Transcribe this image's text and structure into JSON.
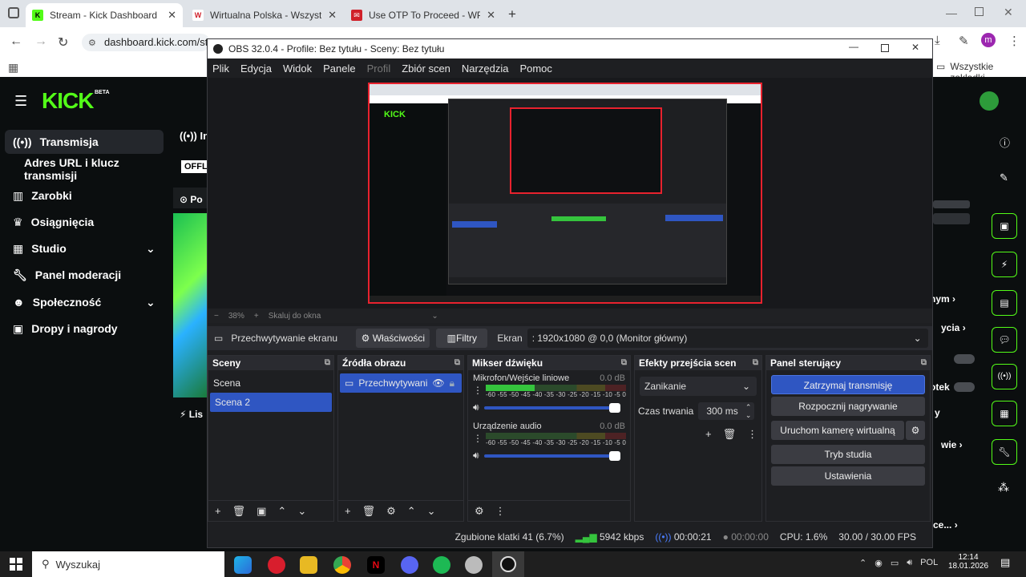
{
  "browser": {
    "tabs": [
      {
        "title": "Stream - Kick Dashboard",
        "active": true
      },
      {
        "title": "Wirtualna Polska - Wszystko co",
        "active": false
      },
      {
        "title": "Use OTP To Proceed - WP Pocz",
        "active": false
      }
    ],
    "address": "dashboard.kick.com/stre",
    "bookmarks_label": "Wszystkie zakładki"
  },
  "kick": {
    "logo": "KICK",
    "logo_badge": "BETA",
    "nav": [
      {
        "label": "Transmisja",
        "icon": "broadcast-icon",
        "active": true
      },
      {
        "label": "Adres URL i klucz transmisji",
        "icon": "",
        "active": false
      },
      {
        "label": "Zarobki",
        "icon": "earnings-icon",
        "active": false
      },
      {
        "label": "Osiągnięcia",
        "icon": "trophy-icon",
        "active": false
      },
      {
        "label": "Studio",
        "icon": "studio-icon",
        "active": false,
        "expandable": true
      },
      {
        "label": "Panel moderacji",
        "icon": "wrench-icon",
        "active": false
      },
      {
        "label": "Społeczność",
        "icon": "community-icon",
        "active": false,
        "expandable": true
      },
      {
        "label": "Dropy i nagrody",
        "icon": "gift-icon",
        "active": false
      }
    ],
    "info_header": "Inf",
    "offline_badge": "OFFL",
    "preview_header": "Po",
    "list_header": "Lis",
    "right_items": [
      "nym",
      "ycia",
      "otek",
      "y",
      "wie",
      "ce..."
    ]
  },
  "obs": {
    "title": "OBS 32.0.4 - Profile: Bez tytułu - Sceny: Bez tytułu",
    "menu": [
      "Plik",
      "Edycja",
      "Widok",
      "Panele",
      "Profil",
      "Zbiór scen",
      "Narzędzia",
      "Pomoc"
    ],
    "zoom": "38%",
    "zoom_mode": "Skaluj do okna",
    "source_bar": {
      "source_name": "Przechwytywanie ekranu",
      "properties_label": "Właściwości",
      "filters_label": "Filtry",
      "screen_label": "Ekran",
      "screen_value": ": 1920x1080 @ 0,0 (Monitor główny)"
    },
    "scenes": {
      "title": "Sceny",
      "items": [
        {
          "name": "Scena",
          "selected": false
        },
        {
          "name": "Scena 2",
          "selected": true
        }
      ]
    },
    "sources": {
      "title": "Źródła obrazu",
      "items": [
        {
          "name": "Przechwytywani",
          "selected": true
        }
      ]
    },
    "mixer": {
      "title": "Mikser dźwięku",
      "channels": [
        {
          "name": "Mikrofon/Wejście liniowe",
          "db": "0.0 dB",
          "level": 0.35
        },
        {
          "name": "Urządzenie audio",
          "db": "0.0 dB",
          "level": 0.0
        }
      ],
      "scale": "-60 -55 -50 -45 -40 -35 -30 -25 -20 -15 -10 -5 0"
    },
    "transitions": {
      "title": "Efekty przejścia scen",
      "selected": "Zanikanie",
      "duration_label": "Czas trwania",
      "duration_value": "300 ms"
    },
    "controls": {
      "title": "Panel sterujący",
      "buttons": [
        "Zatrzymaj transmisję",
        "Rozpocznij nagrywanie",
        "Uruchom kamerę wirtualną",
        "Tryb studia",
        "Ustawienia"
      ]
    },
    "status": {
      "dropped": "Zgubione klatki 41 (6.7%)",
      "bitrate": "5942 kbps",
      "stream_time": "00:00:21",
      "rec_time": "00:00:00",
      "cpu": "CPU: 1.6%",
      "fps": "30.00 / 30.00 FPS"
    }
  },
  "taskbar": {
    "search_placeholder": "Wyszukaj",
    "lang": "POL",
    "time": "12:14",
    "date": "18.01.2026"
  },
  "colors": {
    "kick_green": "#53fc18",
    "obs_blue": "#2f56c2",
    "record_red": "#e8222e"
  }
}
